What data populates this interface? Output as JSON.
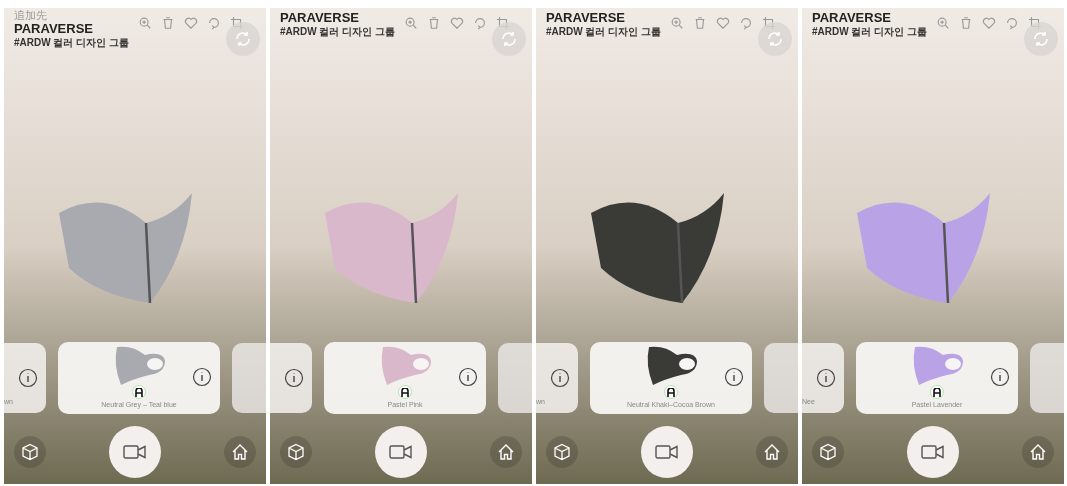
{
  "panels": [
    {
      "corner_text": "追加先",
      "brand": "PARAVERSE",
      "subtitle": "#ARDW 컬러 디자인 그룹",
      "item": {
        "name": "Neutral Grey – Teal blue",
        "color": "#a9a9b0"
      },
      "left_peek": "wn"
    },
    {
      "brand": "PARAVERSE",
      "subtitle": "#ARDW 컬러 디자인 그룹",
      "item": {
        "name": "Pastel Pink",
        "color": "#d9b8cc"
      }
    },
    {
      "brand": "PARAVERSE",
      "subtitle": "#ARDW 컬러 디자인 그룹",
      "item": {
        "name": "Neutral Khaki–Cocoa Brown",
        "color": "#3a3a36"
      },
      "left_peek": "wn"
    },
    {
      "brand": "PARAVERSE",
      "subtitle": "#ARDW 컬러 디자인 그룹",
      "item": {
        "name": "Pastel Lavender",
        "color": "#b9a3e6"
      },
      "left_peek": "Nee"
    }
  ]
}
